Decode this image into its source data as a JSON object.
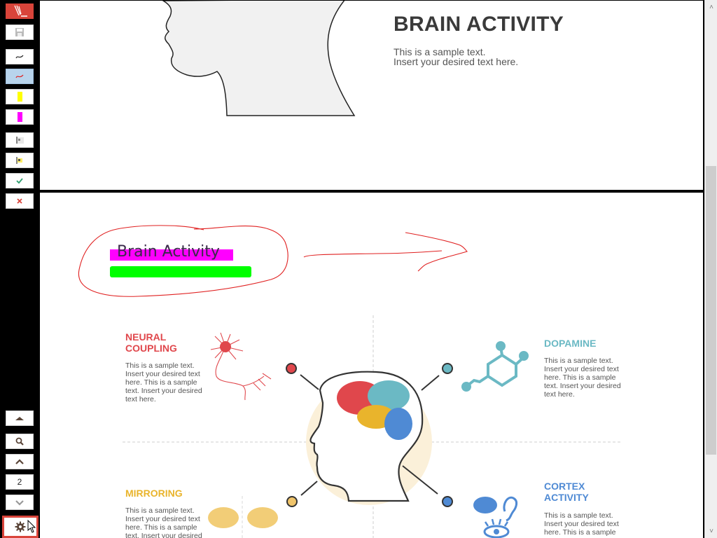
{
  "toolbar": {
    "buttons": [
      {
        "name": "app-logo",
        "icon": "pen-logo-icon"
      },
      {
        "name": "save",
        "icon": "floppy-disk-icon"
      },
      {
        "name": "pen-black",
        "icon": "pen-stroke-black-icon"
      },
      {
        "name": "pen-red",
        "icon": "pen-stroke-red-icon",
        "active": true
      },
      {
        "name": "highlighter-yellow",
        "icon": "highlighter-yellow-icon",
        "color": "#ffff00"
      },
      {
        "name": "highlighter-magenta",
        "icon": "highlighter-magenta-icon",
        "color": "#ff00ff"
      },
      {
        "name": "text-box",
        "icon": "text-box-icon"
      },
      {
        "name": "text-box-highlight",
        "icon": "text-box-highlight-icon"
      },
      {
        "name": "confirm",
        "icon": "check-icon",
        "color": "#2e9e6e"
      },
      {
        "name": "cancel",
        "icon": "close-icon",
        "color": "#d9443a"
      }
    ],
    "navigation": {
      "scroll_top": "triangle-up-icon",
      "search": "search-icon",
      "prev_page": "chevron-up-icon",
      "page_number": "2",
      "next_page": "chevron-down-icon",
      "settings": "gear-icon"
    }
  },
  "page1": {
    "title": "BRAIN ACTIVITY",
    "text_line1": "This is a sample text.",
    "text_line2": "Insert your desired text here."
  },
  "page2": {
    "annotation_text": "Brain Activity",
    "annotation_colors": {
      "pen": "#e02020",
      "highlight_magenta": "#ff00ff",
      "highlight_green": "#00ff00"
    },
    "sections": [
      {
        "id": "neural-coupling",
        "title_line1": "NEURAL",
        "title_line2": "COUPLING",
        "color": "#e0474c",
        "body": [
          "This is a sample text.",
          "Insert your desired text",
          "here. This is a sample",
          "text. Insert your desired",
          "text here."
        ]
      },
      {
        "id": "dopamine",
        "title_line1": "DOPAMINE",
        "title_line2": "",
        "color": "#6bb9c4",
        "body": [
          "This is a sample text.",
          "Insert your desired text",
          "here. This is a sample",
          "text. Insert your desired",
          "text here."
        ]
      },
      {
        "id": "mirroring",
        "title_line1": "MIRRORING",
        "title_line2": "",
        "color": "#e9b42c",
        "body": [
          "This is a sample text.",
          "Insert your desired text",
          "here. This is a sample",
          "text. Insert your desired"
        ]
      },
      {
        "id": "cortex-activity",
        "title_line1": "CORTEX",
        "title_line2": "ACTIVITY",
        "color": "#4f8ad4",
        "body": [
          "This is a sample text.",
          "Insert your desired text",
          "here. This is a sample"
        ]
      }
    ]
  },
  "scrollbar": {
    "position_fraction": 0.31
  }
}
